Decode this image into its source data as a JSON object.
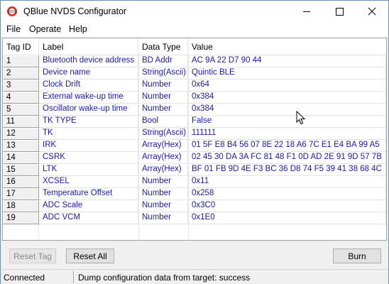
{
  "window": {
    "title": "QBlue NVDS Configurator",
    "icon": "qblue-app-icon"
  },
  "menu": [
    "File",
    "Operate",
    "Help"
  ],
  "table": {
    "columns": [
      "Tag ID",
      "Label",
      "Data Type",
      "Value"
    ],
    "rows": [
      {
        "id": "1",
        "label": "Bluetooth device address",
        "type": "BD Addr",
        "value": "AC 9A 22 D7 90 44"
      },
      {
        "id": "2",
        "label": "Device name",
        "type": "String(Ascii)",
        "value": "Quintic BLE"
      },
      {
        "id": "3",
        "label": "Clock Drift",
        "type": "Number",
        "value": "0x64"
      },
      {
        "id": "4",
        "label": "External wake-up time",
        "type": "Number",
        "value": "0x384"
      },
      {
        "id": "5",
        "label": "Oscillator wake-up time",
        "type": "Number",
        "value": "0x384"
      },
      {
        "id": "11",
        "label": "TK TYPE",
        "type": "Bool",
        "value": "False"
      },
      {
        "id": "12",
        "label": "TK",
        "type": "String(Ascii)",
        "value": "111111"
      },
      {
        "id": "13",
        "label": "IRK",
        "type": "Array(Hex)",
        "value": "01 5F E8 B4 56 07 8E 22 18 A6 7C E1 E4 BA 99 A5"
      },
      {
        "id": "14",
        "label": "CSRK",
        "type": "Array(Hex)",
        "value": "02 45 30 DA 3A FC 81 48 F1 0D AD 2E 91 9D 57 7B"
      },
      {
        "id": "15",
        "label": "LTK",
        "type": "Array(Hex)",
        "value": "BF 01 FB 9D 4E F3 BC 36 D8 74 F5 39 41 38 68 4C"
      },
      {
        "id": "16",
        "label": "XCSEL",
        "type": "Number",
        "value": "0x11"
      },
      {
        "id": "17",
        "label": "Temperature Offset",
        "type": "Number",
        "value": "0x258"
      },
      {
        "id": "18",
        "label": "ADC Scale",
        "type": "Number",
        "value": "0x3C0"
      },
      {
        "id": "19",
        "label": "ADC VCM",
        "type": "Number",
        "value": "0x1E0"
      }
    ]
  },
  "buttons": {
    "reset_tag": "Reset Tag",
    "reset_all": "Reset All",
    "burn": "Burn"
  },
  "status": {
    "connection": "Connected",
    "message": "Dump configuration data from target: success"
  },
  "colors": {
    "value_text": "#1a1ab0",
    "accent": "#d9342b"
  }
}
